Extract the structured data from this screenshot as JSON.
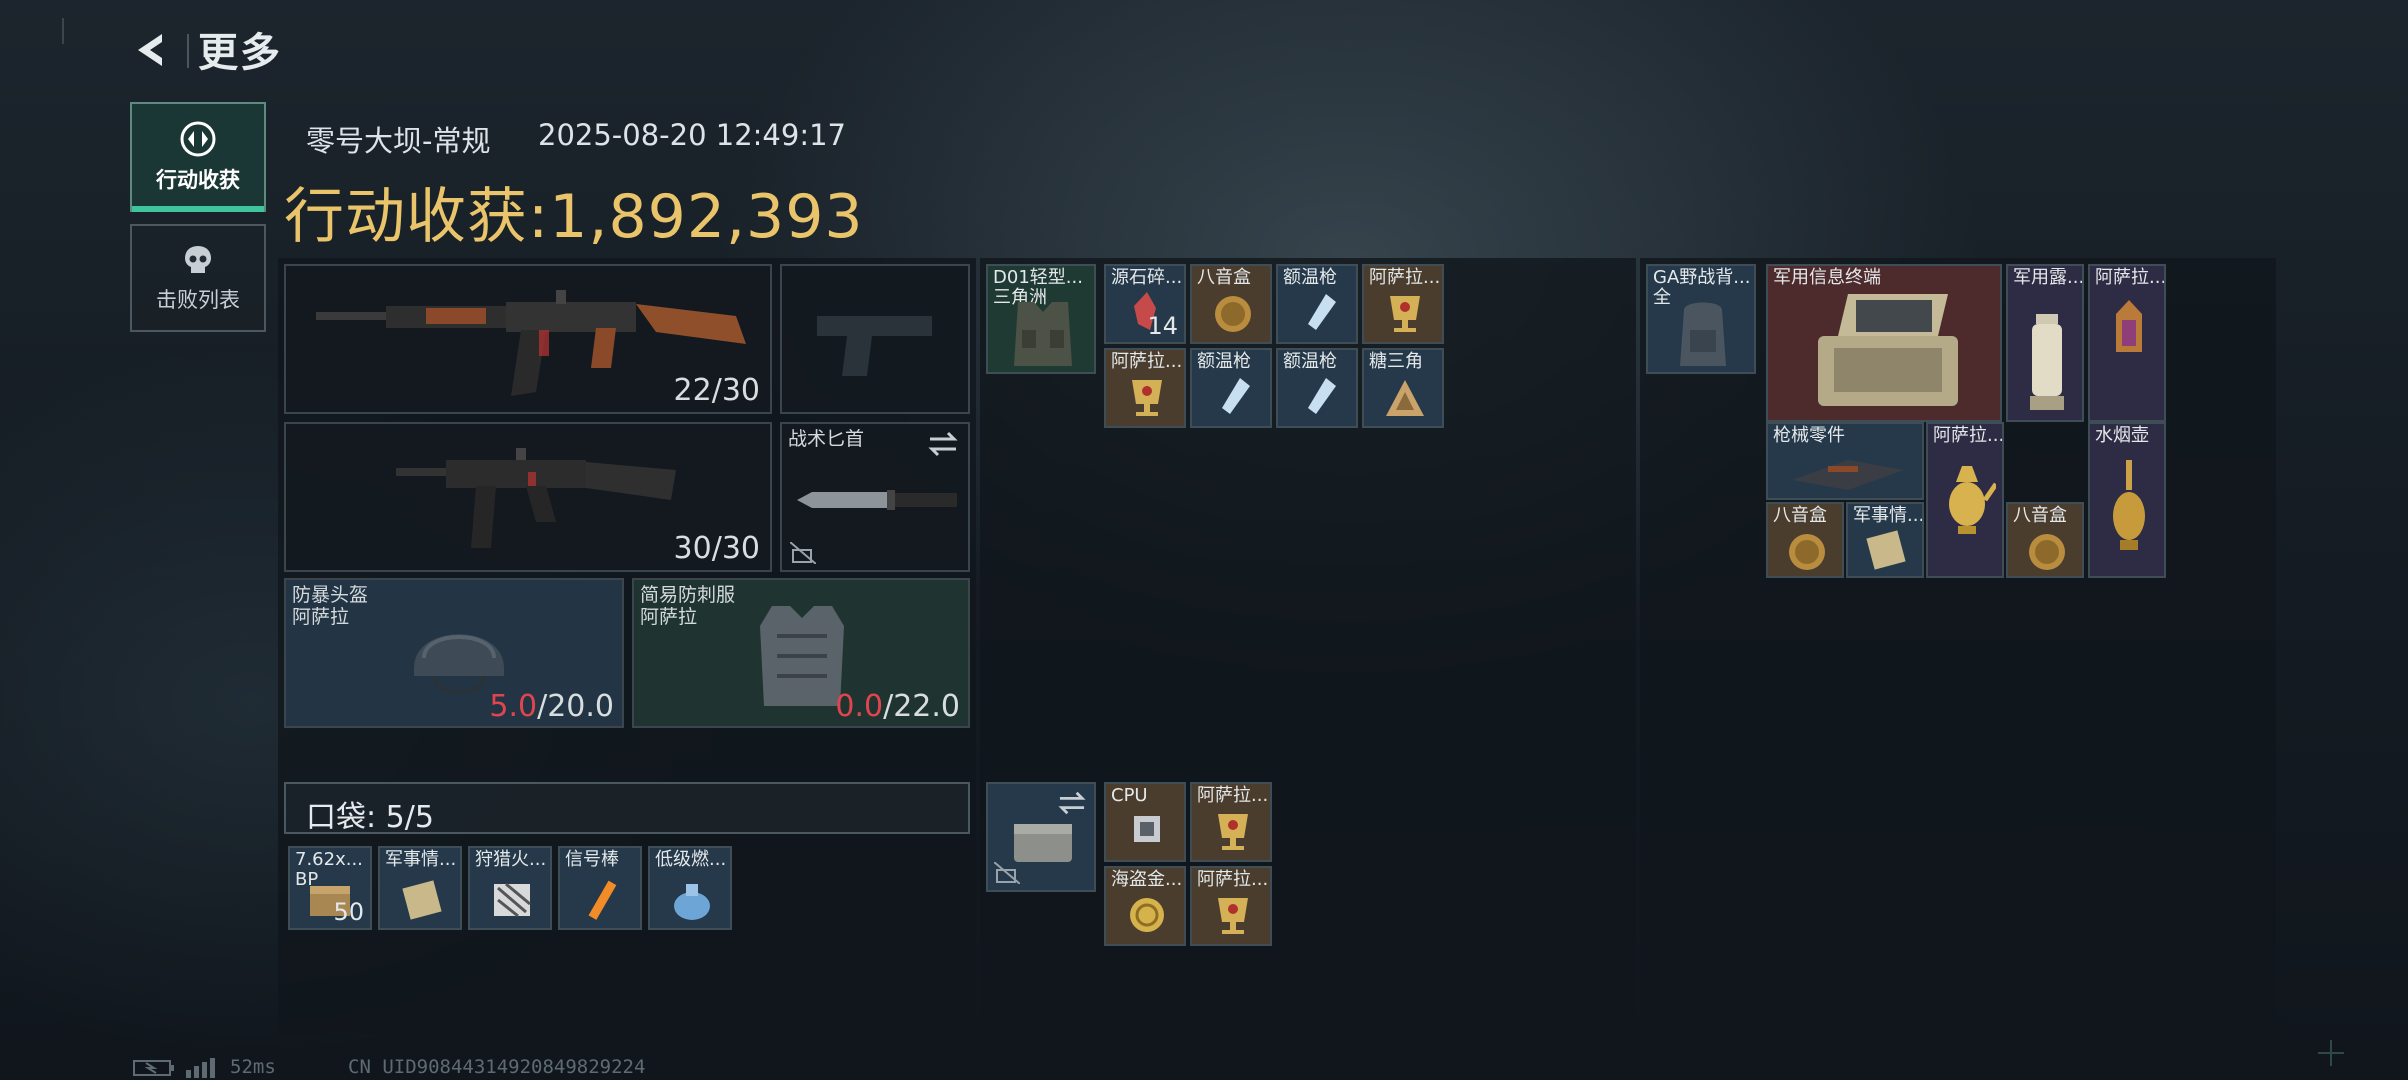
{
  "header": {
    "title": "更多"
  },
  "nav": {
    "haul_label": "行动收获",
    "defeat_label": "击败列表"
  },
  "info": {
    "map": "零号大坝-常规",
    "timestamp": "2025-08-20 12:49:17",
    "haul_label": "行动收获:",
    "haul_value": "1,892,393"
  },
  "loadout": {
    "primary_ammo": "22/30",
    "secondary_ammo": "30/30",
    "knife_label": "战术匕首",
    "helmet": {
      "name": "防暴头盔",
      "sub": "阿萨拉",
      "current": "5.0",
      "max": "/20.0"
    },
    "armor": {
      "name": "简易防刺服",
      "sub": "阿萨拉",
      "current": "0.0",
      "max": "/22.0"
    }
  },
  "pocket": {
    "label": "口袋: 5/5",
    "items": [
      {
        "label": "7.62x...",
        "sub": "BP",
        "count": "50"
      },
      {
        "label": "军事情..."
      },
      {
        "label": "狩猎火..."
      },
      {
        "label": "信号棒"
      },
      {
        "label": "低级燃..."
      }
    ]
  },
  "chest_rig": {
    "label": "D01轻型...",
    "sub": "三角洲",
    "items": [
      {
        "label": "源石碎...",
        "count": "14"
      },
      {
        "label": "八音盒"
      },
      {
        "label": "额温枪"
      },
      {
        "label": "阿萨拉..."
      },
      {
        "label": "阿萨拉..."
      },
      {
        "label": "额温枪"
      },
      {
        "label": "额温枪"
      },
      {
        "label": "糖三角"
      }
    ]
  },
  "safebox": {
    "items": [
      {
        "label": "CPU"
      },
      {
        "label": "阿萨拉..."
      },
      {
        "label": "海盗金..."
      },
      {
        "label": "阿萨拉..."
      }
    ]
  },
  "backpack": {
    "label": "GA野战背...",
    "sub": "全",
    "items": [
      {
        "label": "军用信息终端"
      },
      {
        "label": "军用露..."
      },
      {
        "label": "阿萨拉..."
      },
      {
        "label": "枪械零件"
      },
      {
        "label": "阿萨拉..."
      },
      {
        "label": "水烟壶"
      },
      {
        "label": "八音盒"
      },
      {
        "label": "军事情..."
      },
      {
        "label": "八音盒"
      }
    ]
  },
  "footer": {
    "ping": "52ms",
    "uid": "CN UID9084431492084982922​4"
  }
}
